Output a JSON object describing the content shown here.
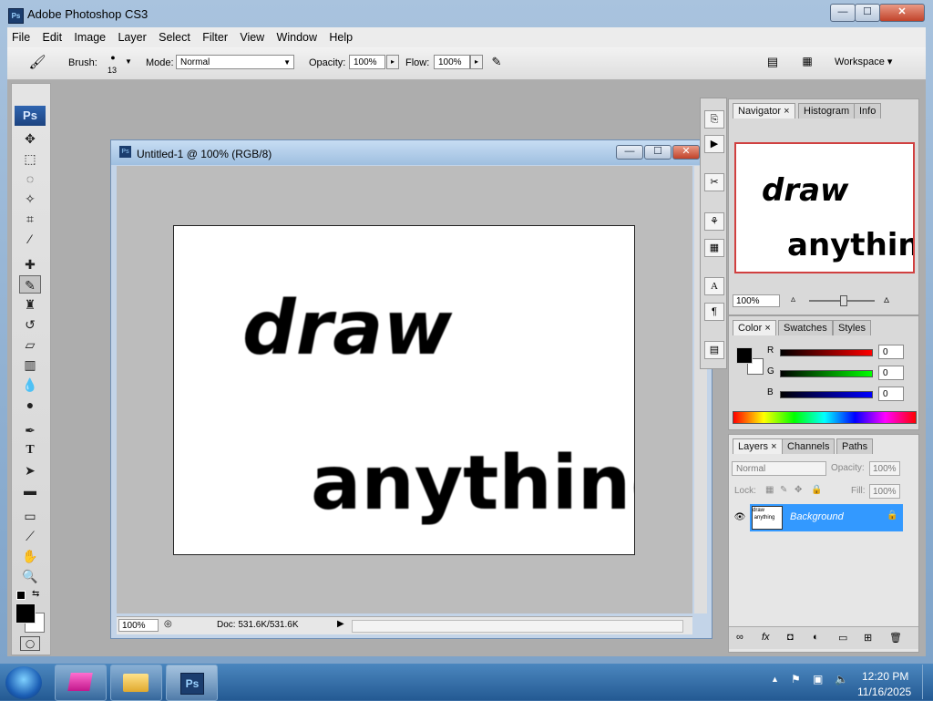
{
  "window": {
    "title": "Adobe Photoshop CS3",
    "app_icon": "Ps",
    "min": "—",
    "max": "☐",
    "close": "✕"
  },
  "menu": [
    "File",
    "Edit",
    "Image",
    "Layer",
    "Select",
    "Filter",
    "View",
    "Window",
    "Help"
  ],
  "options": {
    "brush_label": "Brush:",
    "brush_size": "13",
    "mode_label": "Mode:",
    "mode_value": "Normal",
    "opacity_label": "Opacity:",
    "opacity_value": "100%",
    "flow_label": "Flow:",
    "flow_value": "100%",
    "workspace_label": "Workspace ▾"
  },
  "toolbox": {
    "logo": "Ps"
  },
  "document": {
    "title": "Untitled-1 @ 100% (RGB/8)",
    "zoom": "100%",
    "doc_info": "Doc: 531.6K/531.6K",
    "canvas_text_1": "draw",
    "canvas_text_2": "anything"
  },
  "navigator": {
    "tabs": [
      "Navigator",
      "Histogram",
      "Info"
    ],
    "zoom": "100%",
    "preview_text_1": "draw",
    "preview_text_2": "anything"
  },
  "color_panel": {
    "tabs": [
      "Color",
      "Swatches",
      "Styles"
    ],
    "channels": [
      {
        "label": "R",
        "value": "0",
        "color": "#c00000"
      },
      {
        "label": "G",
        "value": "0",
        "color": "#00a000"
      },
      {
        "label": "B",
        "value": "0",
        "color": "#0000c0"
      }
    ]
  },
  "layers_panel": {
    "tabs": [
      "Layers",
      "Channels",
      "Paths"
    ],
    "blend_mode": "Normal",
    "opacity_label": "Opacity:",
    "opacity_value": "100%",
    "lock_label": "Lock:",
    "fill_label": "Fill:",
    "fill_value": "100%",
    "layer_name": "Background"
  },
  "taskbar": {
    "time": "12:20 PM",
    "date": "11/16/2025",
    "ps_label": "Ps"
  },
  "colors": {
    "accent": "#3399ff",
    "layer_selected": "#3399ff",
    "nav_frame": "#d04040"
  }
}
